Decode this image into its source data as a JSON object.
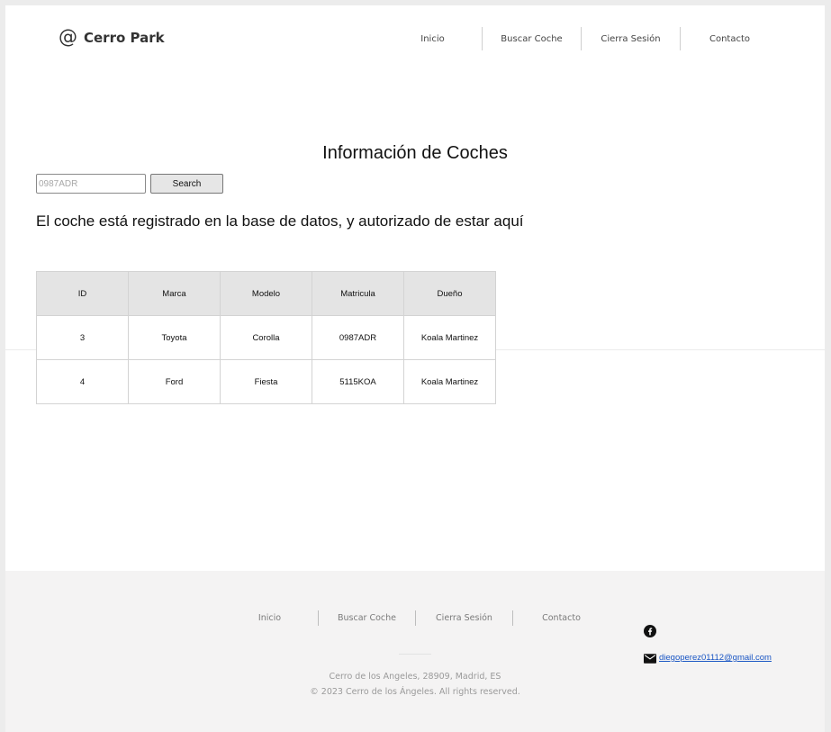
{
  "header": {
    "logo_symbol": "@",
    "logo_text": "Cerro Park",
    "nav": [
      {
        "label": "Inicio"
      },
      {
        "label": "Buscar Coche"
      },
      {
        "label": "Cierra Sesión"
      },
      {
        "label": "Contacto"
      }
    ]
  },
  "main": {
    "title": "Información de Coches",
    "search": {
      "placeholder": "0987ADR",
      "value": "",
      "button_label": "Search"
    },
    "status_message": "El coche está registrado en la base de datos, y autorizado de estar aquí",
    "table": {
      "columns": [
        "ID",
        "Marca",
        "Modelo",
        "Matricula",
        "Dueño"
      ],
      "rows": [
        [
          "3",
          "Toyota",
          "Corolla",
          "0987ADR",
          "Koala Martinez"
        ],
        [
          "4",
          "Ford",
          "Fiesta",
          "5115KOA",
          "Koala Martinez"
        ]
      ]
    }
  },
  "footer": {
    "nav": [
      {
        "label": "Inicio"
      },
      {
        "label": "Buscar Coche"
      },
      {
        "label": "Cierra Sesión"
      },
      {
        "label": "Contacto"
      }
    ],
    "address": "Cerro de los Angeles, 28909, Madrid, ES",
    "copyright": "© 2023 Cerro de los Ángeles.  All rights reserved.",
    "social_icon": "facebook-icon",
    "email_icon": "mail-icon",
    "email": "diegoperez01112@gmail.com"
  },
  "colors": {
    "link": "#1a56c4",
    "footer_bg": "#f4f3f3",
    "table_header_bg": "#e4e4e4"
  }
}
